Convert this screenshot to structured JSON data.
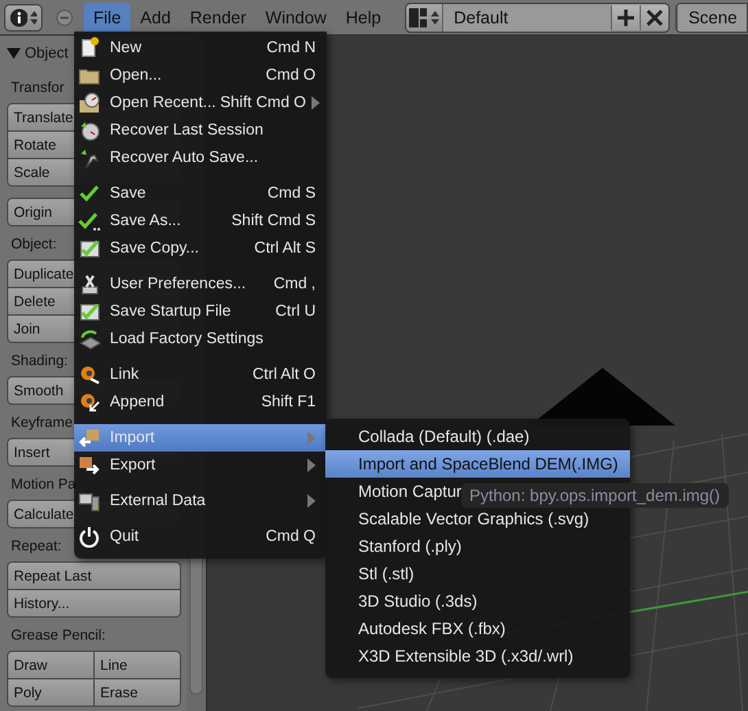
{
  "header": {
    "menus": [
      {
        "label": "File",
        "selected": true
      },
      {
        "label": "Add",
        "selected": false
      },
      {
        "label": "Render",
        "selected": false
      },
      {
        "label": "Window",
        "selected": false
      },
      {
        "label": "Help",
        "selected": false
      }
    ],
    "layout_field": "Default",
    "scene_field": "Scene"
  },
  "tool_shelf": {
    "title": "Object",
    "sections": [
      {
        "heading": "Transfor",
        "rows": [
          [
            "Translate"
          ],
          [
            "Rotate"
          ],
          [
            "Scale"
          ]
        ]
      },
      {
        "rows": [
          [
            "Origin"
          ]
        ]
      },
      {
        "heading": "Object:",
        "rows": [
          [
            "Duplicate"
          ],
          [
            "Delete"
          ],
          [
            "Join"
          ]
        ]
      },
      {
        "heading": "Shading:",
        "rows": [
          [
            "Smooth"
          ]
        ]
      },
      {
        "heading": "Keyframe",
        "rows": [
          [
            "Insert"
          ]
        ]
      },
      {
        "heading": "Motion Pa",
        "rows": [
          [
            "Calculate"
          ]
        ]
      },
      {
        "heading": "Repeat:",
        "rows": [
          [
            "Repeat Last"
          ],
          [
            "History..."
          ]
        ]
      },
      {
        "heading": "Grease Pencil:",
        "rows": [
          [
            "Draw",
            "Line"
          ],
          [
            "Poly",
            "Erase"
          ]
        ]
      }
    ]
  },
  "file_menu": [
    {
      "kind": "item",
      "label": "New",
      "shortcut": "Cmd N",
      "submenu": false,
      "selected": false
    },
    {
      "kind": "item",
      "label": "Open...",
      "shortcut": "Cmd O",
      "submenu": false,
      "selected": false
    },
    {
      "kind": "item",
      "label": "Open Recent...",
      "shortcut": "Shift Cmd O",
      "submenu": true,
      "selected": false
    },
    {
      "kind": "item",
      "label": "Recover Last Session",
      "submenu": false,
      "selected": false
    },
    {
      "kind": "item",
      "label": "Recover Auto Save...",
      "submenu": false,
      "selected": false
    },
    {
      "kind": "separator"
    },
    {
      "kind": "item",
      "label": "Save",
      "shortcut": "Cmd S",
      "submenu": false,
      "selected": false
    },
    {
      "kind": "item",
      "label": "Save As...",
      "shortcut": "Shift Cmd S",
      "submenu": false,
      "selected": false
    },
    {
      "kind": "item",
      "label": "Save Copy...",
      "shortcut": "Ctrl Alt S",
      "submenu": false,
      "selected": false
    },
    {
      "kind": "separator"
    },
    {
      "kind": "item",
      "label": "User Preferences...",
      "shortcut": "Cmd ,",
      "submenu": false,
      "selected": false
    },
    {
      "kind": "item",
      "label": "Save Startup File",
      "shortcut": "Ctrl U",
      "submenu": false,
      "selected": false
    },
    {
      "kind": "item",
      "label": "Load Factory Settings",
      "submenu": false,
      "selected": false
    },
    {
      "kind": "separator"
    },
    {
      "kind": "item",
      "label": "Link",
      "shortcut": "Ctrl Alt O",
      "submenu": false,
      "selected": false
    },
    {
      "kind": "item",
      "label": "Append",
      "shortcut": "Shift F1",
      "submenu": false,
      "selected": false
    },
    {
      "kind": "separator"
    },
    {
      "kind": "item",
      "label": "Import",
      "submenu": true,
      "selected": true
    },
    {
      "kind": "item",
      "label": "Export",
      "submenu": true,
      "selected": false
    },
    {
      "kind": "separator"
    },
    {
      "kind": "item",
      "label": "External Data",
      "submenu": true,
      "selected": false
    },
    {
      "kind": "separator"
    },
    {
      "kind": "item",
      "label": "Quit",
      "shortcut": "Cmd Q",
      "submenu": false,
      "selected": false
    }
  ],
  "import_menu": [
    {
      "label": "Collada (Default) (.dae)",
      "selected": false
    },
    {
      "label": "Import and SpaceBlend DEM(.IMG)",
      "selected": true
    },
    {
      "label": "Motion Captur",
      "selected": false
    },
    {
      "label": "Scalable Vector Graphics (.svg)",
      "selected": false
    },
    {
      "label": "Stanford (.ply)",
      "selected": false
    },
    {
      "label": "Stl (.stl)",
      "selected": false
    },
    {
      "label": "3D Studio (.3ds)",
      "selected": false
    },
    {
      "label": "Autodesk FBX (.fbx)",
      "selected": false
    },
    {
      "label": "X3D Extensible 3D (.x3d/.wrl)",
      "selected": false
    }
  ],
  "tooltip": "Python: bpy.ops.import_dem.img()"
}
